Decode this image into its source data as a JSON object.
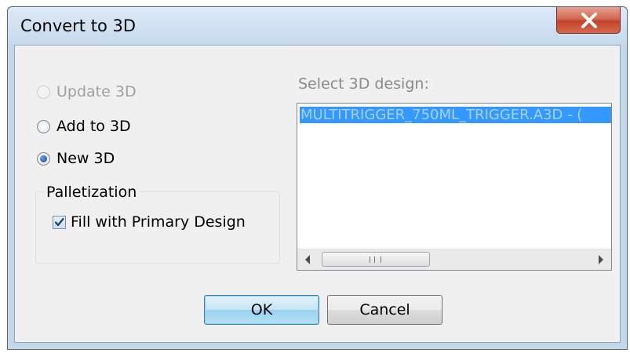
{
  "window": {
    "title": "Convert to 3D"
  },
  "options": {
    "update": {
      "label": "Update 3D",
      "enabled": false,
      "selected": false
    },
    "add": {
      "label": "Add to 3D",
      "enabled": true,
      "selected": false
    },
    "new": {
      "label": "New 3D",
      "enabled": true,
      "selected": true
    }
  },
  "palletization": {
    "group_label": "Palletization",
    "fill_label": "Fill with Primary Design",
    "fill_checked": true
  },
  "design_list": {
    "label": "Select 3D design:",
    "items": [
      "MULTITRIGGER_750ML_TRIGGER.A3D - ("
    ],
    "selected_index": 0
  },
  "buttons": {
    "ok": "OK",
    "cancel": "Cancel"
  },
  "icons": {
    "close": "close-icon"
  },
  "colors": {
    "selection": "#3399ff",
    "close_button": "#c0442a"
  }
}
